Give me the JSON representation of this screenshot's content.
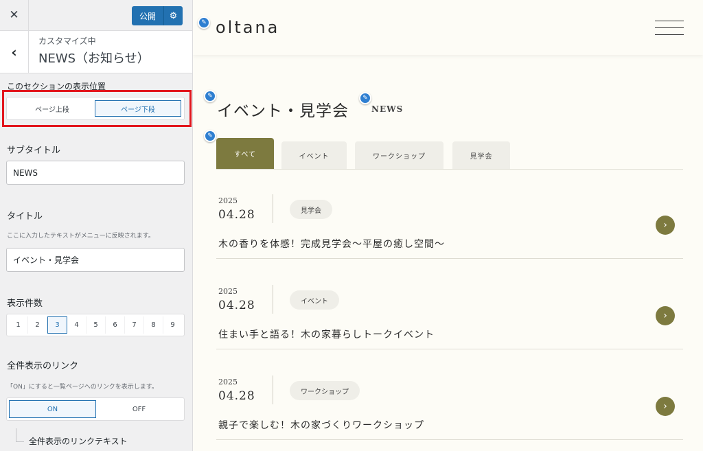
{
  "panel": {
    "close_icon": "close-icon",
    "publish_label": "公開",
    "publish_icon": "gear-icon",
    "back_icon": "chevron-left-icon",
    "header_sub": "カスタマイズ中",
    "header_title": "NEWS（お知らせ）",
    "position_label": "このセクションの表示位置",
    "position_options": [
      "ページ上段",
      "ページ下段"
    ],
    "position_selected": "ページ下段",
    "subtitle_label": "サブタイトル",
    "subtitle_value": "NEWS",
    "title_label": "タイトル",
    "title_desc": "ここに入力したテキストがメニューに反映されます。",
    "title_value": "イベント・見学会",
    "count_label": "表示件数",
    "count_options": [
      "1",
      "2",
      "3",
      "4",
      "5",
      "6",
      "7",
      "8",
      "9"
    ],
    "count_selected": "3",
    "link_label": "全件表示のリンク",
    "link_desc": "「ON」にすると一覧ページへのリンクを表示します。",
    "link_options": [
      "ON",
      "OFF"
    ],
    "link_selected": "ON",
    "link_text_label": "全件表示のリンクテキスト",
    "highlight_color": "#e2161d",
    "accent_color": "#2271b1"
  },
  "preview": {
    "logo": "oltana",
    "menu_icon": "hamburger-icon",
    "edit_icon": "pencil-icon",
    "section_title": "イベント・見学会",
    "section_subtitle": "NEWS",
    "tabs": [
      "すべて",
      "イベント",
      "ワークショップ",
      "見学会"
    ],
    "active_tab": "すべて",
    "accent_color": "#7d7a3f",
    "news": [
      {
        "year": "2025",
        "date": "04.28",
        "category": "見学会",
        "title": "木の香りを体感！完成見学会〜平屋の癒し空間〜"
      },
      {
        "year": "2025",
        "date": "04.28",
        "category": "イベント",
        "title": "住まい手と語る！木の家暮らしトークイベント"
      },
      {
        "year": "2025",
        "date": "04.28",
        "category": "ワークショップ",
        "title": "親子で楽しむ！木の家づくりワークショップ"
      }
    ],
    "arrow_icon": "chevron-right-icon"
  }
}
